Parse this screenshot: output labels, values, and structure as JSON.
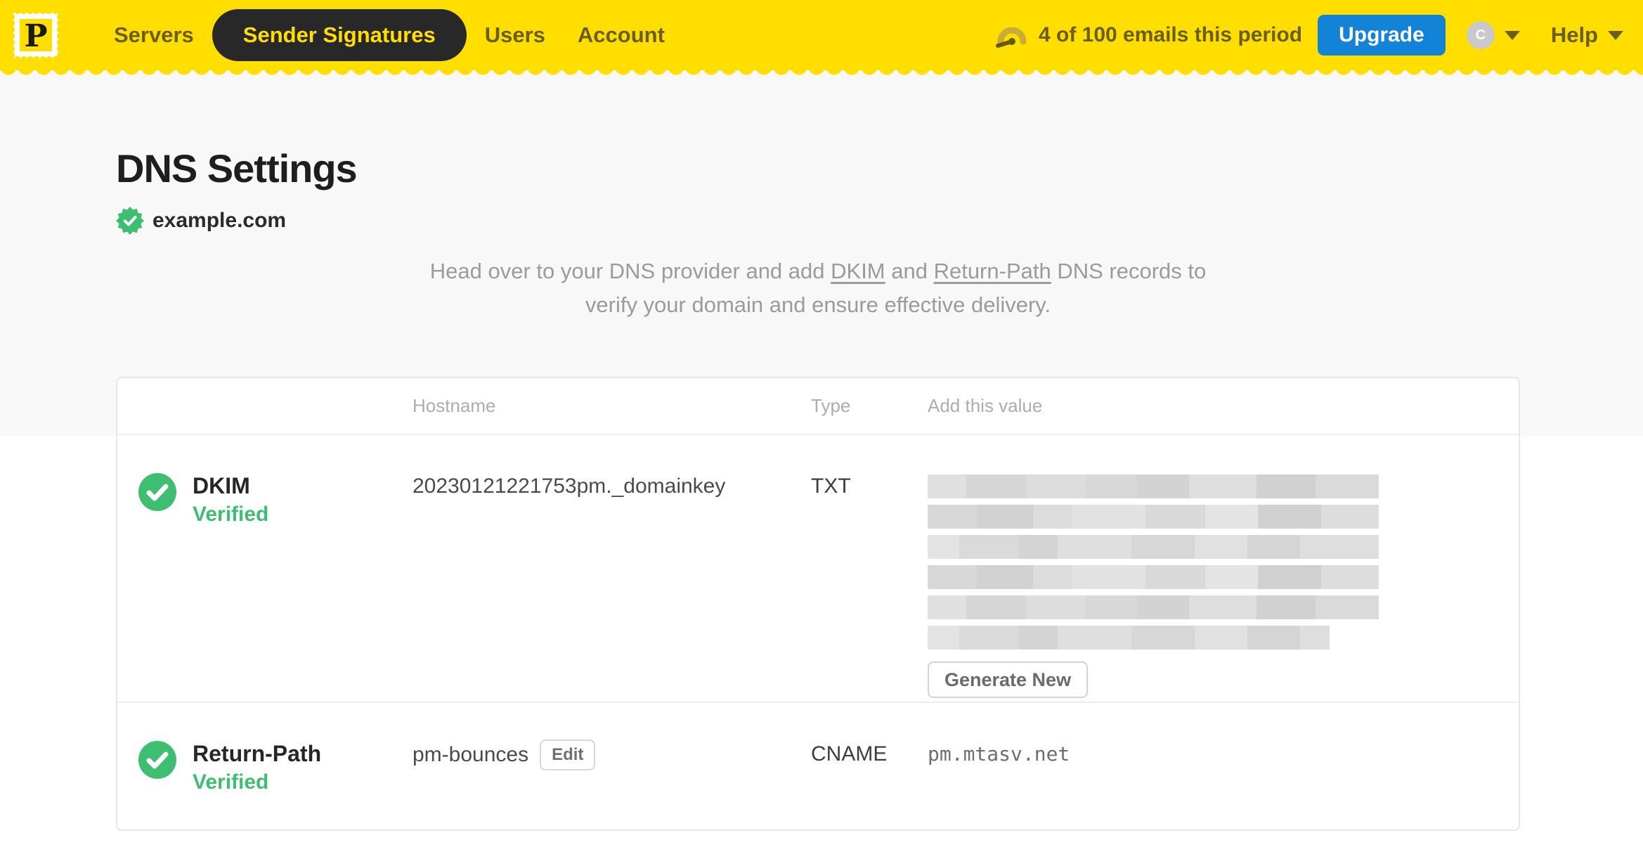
{
  "nav": {
    "logo_letter": "P",
    "items": [
      {
        "label": "Servers",
        "active": false
      },
      {
        "label": "Sender Signatures",
        "active": true
      },
      {
        "label": "Users",
        "active": false
      },
      {
        "label": "Account",
        "active": false
      }
    ],
    "usage_text": "4 of 100 emails this period",
    "upgrade_label": "Upgrade",
    "avatar_initial": "C",
    "help_label": "Help"
  },
  "page": {
    "title": "DNS Settings",
    "domain": "example.com",
    "domain_status": "verified",
    "intro": {
      "pre": "Head over to your DNS provider and add ",
      "link_dkim": "DKIM",
      "mid": " and ",
      "link_return_path": "Return-Path",
      "post": " DNS records to",
      "line2": "verify your domain and ensure effective delivery."
    }
  },
  "table": {
    "headers": {
      "hostname": "Hostname",
      "type": "Type",
      "value": "Add this value"
    },
    "rows": [
      {
        "name": "DKIM",
        "status": "Verified",
        "hostname": "20230121221753pm._domainkey",
        "type": "TXT",
        "value": "[redacted]",
        "value_redacted_rows": 6,
        "action_label": "Generate New"
      },
      {
        "name": "Return-Path",
        "status": "Verified",
        "hostname": "pm-bounces",
        "edit_label": "Edit",
        "type": "CNAME",
        "value": "pm.mtasv.net"
      }
    ]
  },
  "colors": {
    "brand_yellow": "#FFDE00",
    "nav_text": "#6B5E1C",
    "active_pill_bg": "#282828",
    "upgrade_blue": "#1283D6",
    "verified_green": "#3EBE71",
    "page_bg": "#F8F8F8",
    "card_border": "#E8E8E8",
    "muted_text": "#9B9B9B"
  }
}
